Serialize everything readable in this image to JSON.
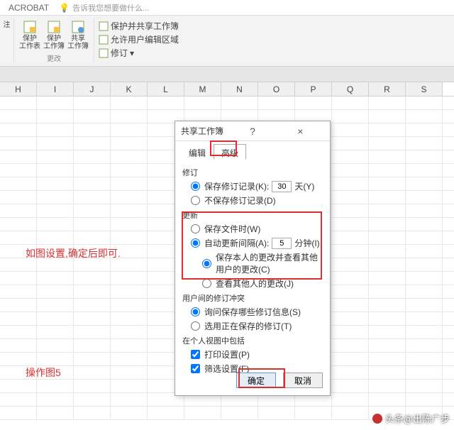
{
  "menubar": {
    "acrobat": "ACROBAT",
    "tell": "告诉我您想要做什么..."
  },
  "ribbon": {
    "note": "注",
    "protect_sheet": "保护\n工作表",
    "protect_book": "保护\n工作簿",
    "share_book": "共享\n工作簿",
    "protect_share": "保护并共享工作簿",
    "allow_edit": "允许用户编辑区域",
    "track_changes": "修订",
    "group_label": "更改"
  },
  "cols": [
    "H",
    "I",
    "J",
    "K",
    "L",
    "M",
    "N",
    "O",
    "P",
    "Q",
    "R",
    "S"
  ],
  "anno": {
    "a1": "如图设置,确定后即可.",
    "a2": "操作图5"
  },
  "dlg": {
    "title": "共享工作簿",
    "help": "?",
    "close": "×",
    "tab_edit": "编辑",
    "tab_adv": "高级",
    "sect_track": "修订",
    "keep_history": "保存修订记录(K):",
    "days_val": "30",
    "days_unit": "天(Y)",
    "no_history": "不保存修订记录(D)",
    "sect_update": "更新",
    "on_save": "保存文件时(W)",
    "auto_every": "自动更新间隔(A):",
    "interval_val": "5",
    "interval_unit": "分钟(I)",
    "save_mine_see": "保存本人的更改并查看其他用户的更改(C)",
    "see_others": "查看其他人的更改(J)",
    "sect_conflict": "用户间的修订冲突",
    "ask_which": "询问保存哪些修订信息(S)",
    "use_saving": "选用正在保存的修订(T)",
    "sect_personal": "在个人视图中包括",
    "print_set": "打印设置(P)",
    "filter_set": "筛选设置(F)",
    "ok": "确定",
    "cancel": "取消"
  },
  "watermark": "头条@出陈广步"
}
